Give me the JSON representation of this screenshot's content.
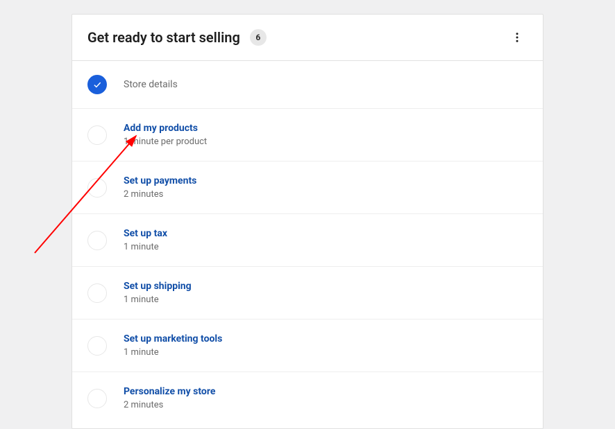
{
  "header": {
    "title": "Get ready to start selling",
    "badge_count": "6"
  },
  "tasks": [
    {
      "label": "Store details",
      "time": "",
      "complete": true
    },
    {
      "label": "Add my products",
      "time": "1 minute per product",
      "complete": false
    },
    {
      "label": "Set up payments",
      "time": "2 minutes",
      "complete": false
    },
    {
      "label": "Set up tax",
      "time": "1 minute",
      "complete": false
    },
    {
      "label": "Set up shipping",
      "time": "1 minute",
      "complete": false
    },
    {
      "label": "Set up marketing tools",
      "time": "1 minute",
      "complete": false
    },
    {
      "label": "Personalize my store",
      "time": "2 minutes",
      "complete": false
    }
  ]
}
